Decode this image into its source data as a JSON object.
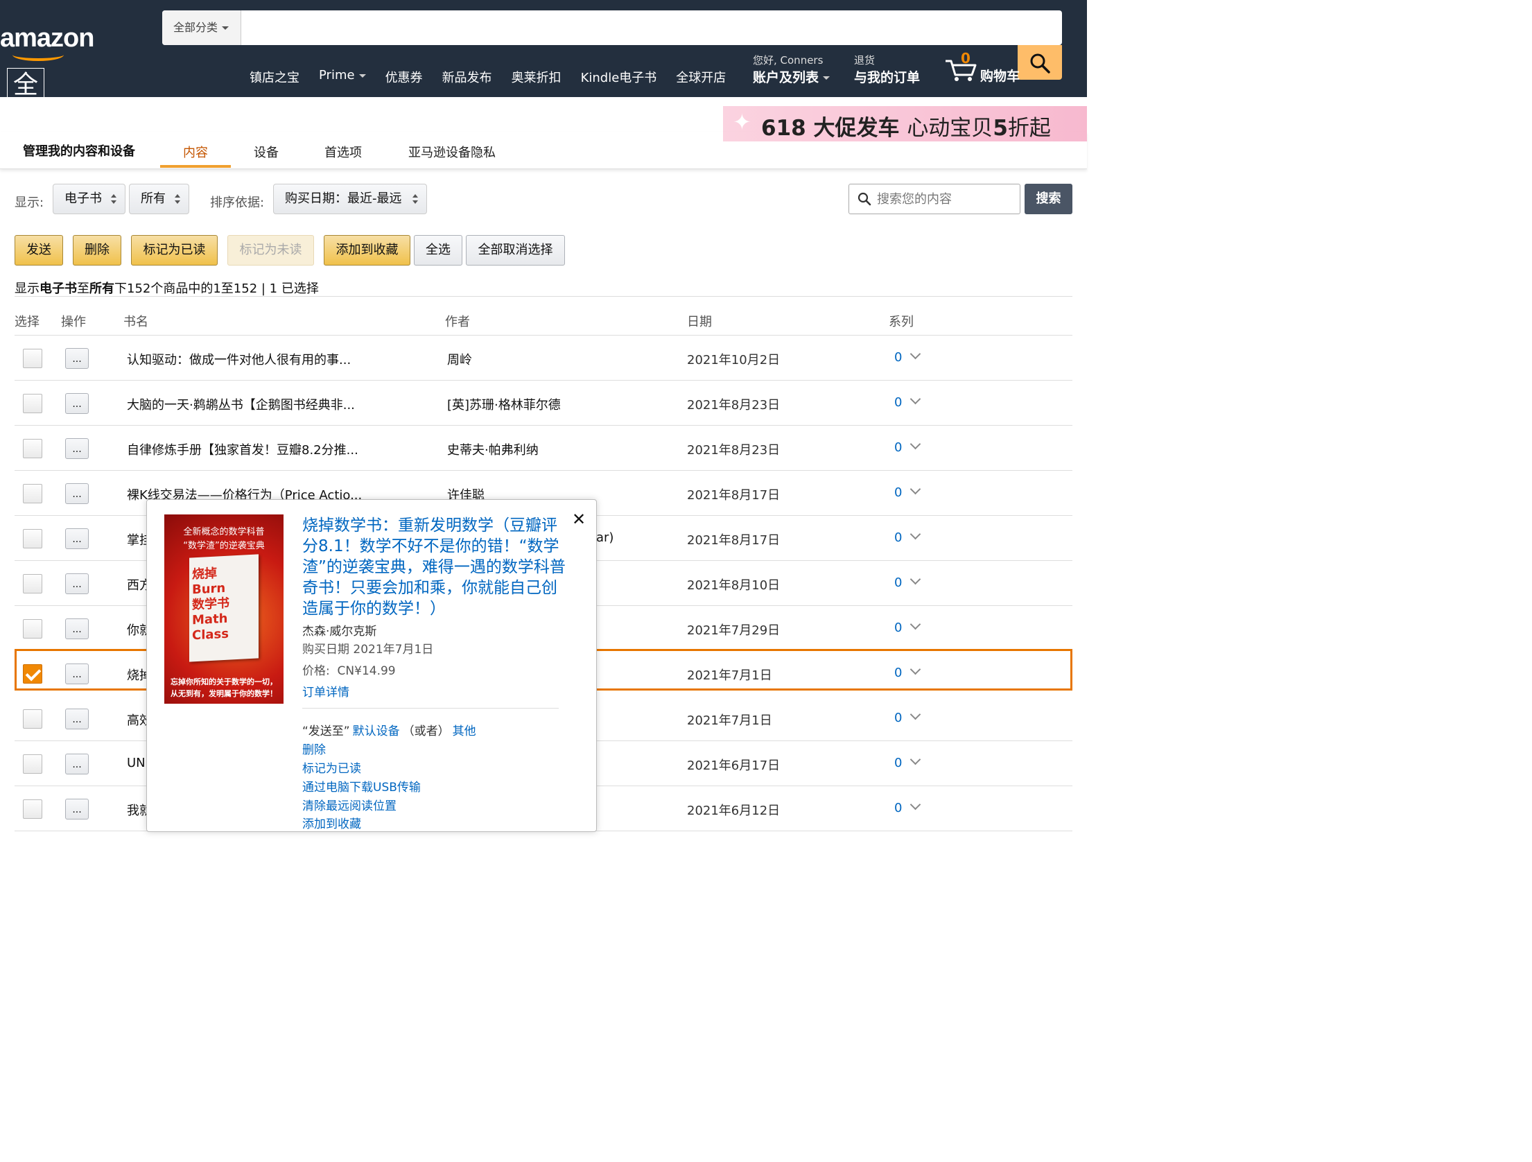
{
  "header": {
    "logo_text": "amazon",
    "logo_badge": "全",
    "category_dropdown": "全部分类",
    "search_value": "",
    "nav_links": [
      "镇店之宝",
      "Prime",
      "优惠券",
      "新品发布",
      "奥莱折扣",
      "Kindle电子书",
      "全球开店"
    ],
    "greeting": "您好, Conners",
    "account_label": "账户及列表",
    "returns_small": "退货",
    "orders_label": "与我的订单",
    "cart_count": "0",
    "cart_label": "购物车"
  },
  "promo": {
    "part1": "618 大促发车",
    "part2": "心动宝贝",
    "part3": "5",
    "part4": "折起"
  },
  "tabs": {
    "title": "管理我的内容和设备",
    "items": [
      "内容",
      "设备",
      "首选项",
      "亚马逊设备隐私"
    ],
    "active": "内容"
  },
  "filters": {
    "show_label": "显示:",
    "type_value": "电子书",
    "scope_value": "所有",
    "sort_label": "排序依据:",
    "sort_value": "购买日期：最近-最远",
    "search_placeholder": "搜索您的内容",
    "search_button": "搜索"
  },
  "actions": {
    "send": "发送",
    "delete": "删除",
    "mark_read": "标记为已读",
    "mark_unread": "标记为未读",
    "add_collection": "添加到收藏",
    "select_all": "全选",
    "deselect_all": "全部取消选择"
  },
  "summary": {
    "prefix": "显示",
    "bold1": "电子书",
    "mid1": "至",
    "bold2": "所有",
    "rest": "下152个商品中的1至152 | 1 已选择"
  },
  "table": {
    "headers": [
      "选择",
      "操作",
      "书名",
      "作者",
      "日期",
      "系列"
    ],
    "rows": [
      {
        "title": "认知驱动：做成一件对他人很有用的事...",
        "author": "周岭",
        "date": "2021年10月2日",
        "series": "0",
        "checked": false
      },
      {
        "title": "大脑的一天·鹈鹕丛书【企鹅图书经典非...",
        "author": "[英]苏珊·格林菲尔德",
        "date": "2021年8月23日",
        "series": "0",
        "checked": false
      },
      {
        "title": "自律修炼手册【独家首发！豆瓣8.2分推...",
        "author": "史蒂夫·帕弗利纳",
        "date": "2021年8月23日",
        "series": "0",
        "checked": false
      },
      {
        "title": "裸K线交易法——价格行为（Price Actio...",
        "author": "许佳聪",
        "date": "2021年8月17日",
        "series": "0",
        "checked": false
      },
      {
        "title": "掌挂",
        "author": "ar)",
        "date": "2021年8月17日",
        "series": "0",
        "checked": false
      },
      {
        "title": "西方",
        "author": "",
        "date": "2021年8月10日",
        "series": "0",
        "checked": false
      },
      {
        "title": "你就",
        "author": "",
        "date": "2021年7月29日",
        "series": "0",
        "checked": false
      },
      {
        "title": "烧掉",
        "author": "",
        "date": "2021年7月1日",
        "series": "0",
        "checked": true
      },
      {
        "title": "高效",
        "author": "",
        "date": "2021年7月1日",
        "series": "0",
        "checked": false
      },
      {
        "title": "UN",
        "author": "",
        "date": "2021年6月17日",
        "series": "0",
        "checked": false
      },
      {
        "title": "我就",
        "author": "",
        "date": "2021年6月12日",
        "series": "0",
        "checked": false
      }
    ],
    "action_label": "..."
  },
  "popover": {
    "cover_top": "全新概念的数学科普\n“数学渣”的逆袭宝典",
    "cover_title": "烧掉\nBurn\n数学书\nMath\nClass",
    "cover_bottom": "忘掉你所知的关于数学的一切，\n从无到有，发明属于你的数学！",
    "title": "烧掉数学书：重新发明数学（豆瓣评分8.1！数学不好不是你的错！“数学渣”的逆袭宝典，难得一遇的数学科普奇书！只要会加和乘，你就能自己创造属于你的数学！）",
    "author": "杰森·威尔克斯",
    "purchase_date": "购买日期 2021年7月1日",
    "price_label": "价格:",
    "price_value": "CN¥14.99",
    "order_details": "订单详情",
    "send_to": "“发送至”",
    "default_device": "默认设备",
    "or": "（或者）",
    "other": "其他",
    "delete": "删除",
    "mark_read": "标记为已读",
    "usb": "通过电脑下载USB传输",
    "clear_position": "清除最远阅读位置",
    "add_collection": "添加到收藏"
  },
  "colors": {
    "nav_bg": "#232f3e",
    "accent": "#e77600",
    "link": "#0066c0",
    "button_yellow": "#f0c14b"
  }
}
